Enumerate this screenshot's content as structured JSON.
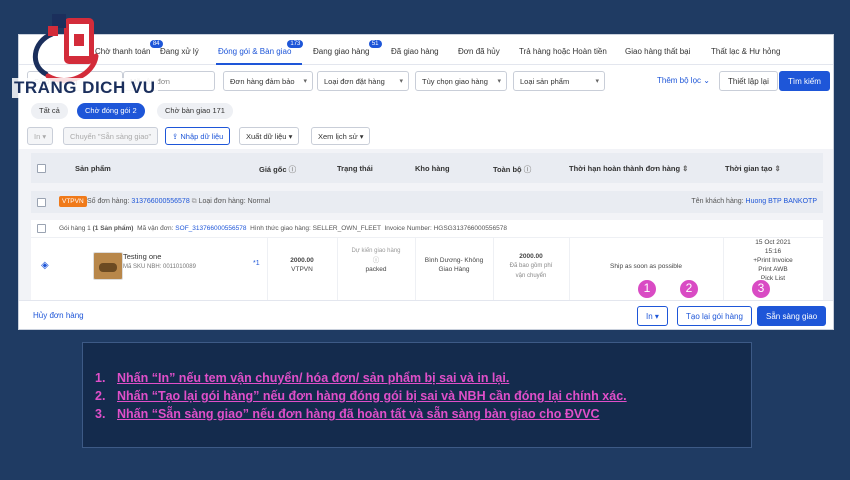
{
  "logo": {
    "text": "TRANG DICH VU"
  },
  "tabs": [
    {
      "label": "Chờ thanh toán",
      "count": "84"
    },
    {
      "label": "Đang xử lý"
    },
    {
      "label": "Đóng gói & Bàn giao",
      "count": "173",
      "active": true
    },
    {
      "label": "Đang giao hàng",
      "count": "51"
    },
    {
      "label": "Đã giao hàng"
    },
    {
      "label": "Đơn đã hủy"
    },
    {
      "label": "Trả hàng hoặc Hoàn tiền"
    },
    {
      "label": "Giao hàng thất bại"
    },
    {
      "label": "Thất lạc & Hư hỏng"
    }
  ],
  "filters": {
    "order_number_placeholder": "Số đơn hàng",
    "tracking_placeholder": "Mã vận đơn",
    "guaranteed": "Đơn hàng đảm bảo",
    "order_type": "Loại đơn đặt hàng",
    "delivery_option": "Tùy chọn giao hàng",
    "product_type": "Loại sản phẩm",
    "more_filters": "Thêm bộ lọc",
    "reset": "Thiết lập lại",
    "search": "Tìm kiếm"
  },
  "pills": [
    {
      "label": "Tất cả"
    },
    {
      "label": "Chờ đóng gói 2",
      "active": true
    },
    {
      "label": "Chờ bàn giao 171"
    }
  ],
  "actions": {
    "print": "In",
    "ready_bulk": "Chuyển \"Sẵn sàng giao\"",
    "import": "Nhập dữ liệu",
    "export": "Xuất dữ liệu",
    "history": "Xem lịch sử"
  },
  "table": {
    "headers": [
      "Sản phẩm",
      "Giá gốc",
      "Trạng thái",
      "Kho hàng",
      "Toàn bộ",
      "Thời hạn hoàn thành đơn hàng",
      "Thời gian tạo"
    ]
  },
  "order": {
    "badge": "VTPVN",
    "number_label": "Số đơn hàng:",
    "number": "313766000556578",
    "type_label": "Loại đơn hàng:",
    "type": "Normal",
    "customer_label": "Tên khách hàng:",
    "customer": "Huong BTP BANKOTP",
    "package_label": "Gói hàng 1",
    "package_count": "(1 Sản phẩm)",
    "tracking_label": "Mã vận đơn:",
    "tracking": "SOF_313766000556578",
    "shipping_label": "Hình thức giao hàng:",
    "shipping": "SELLER_OWN_FLEET",
    "invoice_label": "Invoice Number:",
    "invoice": "HGSG313766000556578"
  },
  "item": {
    "name": "Testing one",
    "sku": "Mã SKU NBH: 0011010089",
    "qty": "*1",
    "price": "2000.00",
    "currency": "VTPVN",
    "status_line1": "Dự kiến giao hàng",
    "status_line2": "packed",
    "warehouse_line1": "Bình Dương- Không",
    "warehouse_line2": "Giao Hàng",
    "total": "2000.00",
    "total_note1": "Đã bao gồm phí",
    "total_note2": "vận chuyển",
    "deadline": "Ship as soon as possible",
    "created_date": "15 Oct 2021",
    "created_time": "15:16",
    "op1": "+Print Invoice",
    "op2": "Print AWB",
    "op3": "Pick List"
  },
  "footer": {
    "cancel": "Hủy đơn hàng",
    "print": "In",
    "repack": "Tạo lại gói hàng",
    "ready": "Sẵn sàng giao"
  },
  "markers": [
    "1",
    "2",
    "3"
  ],
  "instructions": [
    {
      "num": "1.",
      "text": "Nhấn “In” nếu tem vận chuyển/ hóa đơn/ sản phẩm bị sai và in lại."
    },
    {
      "num": "2.",
      "text": "Nhấn “Tạo lại gói hàng” nếu đơn hàng đóng gói bị sai và NBH cần đóng lại chính xác."
    },
    {
      "num": "3.",
      "text": "Nhấn “Sẵn sàng giao” nếu đơn hàng đã hoàn tất và sẵn sàng bàn giao cho ĐVVC"
    }
  ],
  "colors": {
    "accent": "#1e56d8",
    "marker": "#d94bc4",
    "background": "#1f3b63"
  }
}
